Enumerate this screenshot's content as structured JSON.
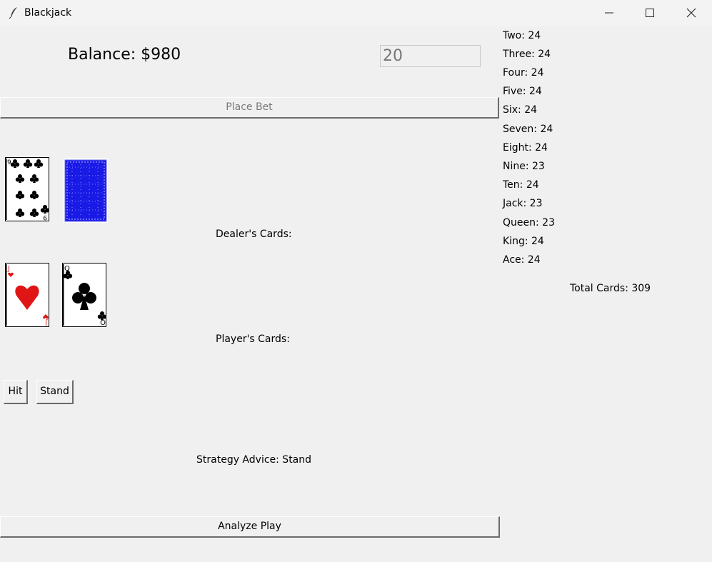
{
  "window": {
    "title": "Blackjack"
  },
  "balance": "Balance: $980",
  "bet": {
    "value": "20"
  },
  "buttons": {
    "place_bet": "Place Bet",
    "hit": "Hit",
    "stand": "Stand",
    "analyze": "Analyze Play"
  },
  "dealer": {
    "label": "Dealer's Cards:",
    "cards": [
      {
        "rank": "9",
        "suit": "clubs",
        "face": "up"
      },
      {
        "face": "down",
        "back_color": "#1a1ae6"
      }
    ]
  },
  "player": {
    "label": "Player's Cards:",
    "cards": [
      {
        "rank": "J",
        "suit": "hearts",
        "face": "up"
      },
      {
        "rank": "Q",
        "suit": "clubs",
        "face": "up"
      }
    ]
  },
  "advice": "Strategy Advice: Stand",
  "counts": [
    "Two: 24",
    "Three: 24",
    "Four: 24",
    "Five: 24",
    "Six: 24",
    "Seven: 24",
    "Eight: 24",
    "Nine: 23",
    "Ten: 24",
    "Jack: 23",
    "Queen: 23",
    "King: 24",
    "Ace: 24"
  ],
  "total": "Total Cards: 309",
  "colors": {
    "background": "#f0f0f0",
    "heart_red": "#e01515",
    "card_back": "#1a1ae6"
  },
  "icons": [
    "feather-icon",
    "minimize-icon",
    "maximize-icon",
    "close-icon"
  ]
}
